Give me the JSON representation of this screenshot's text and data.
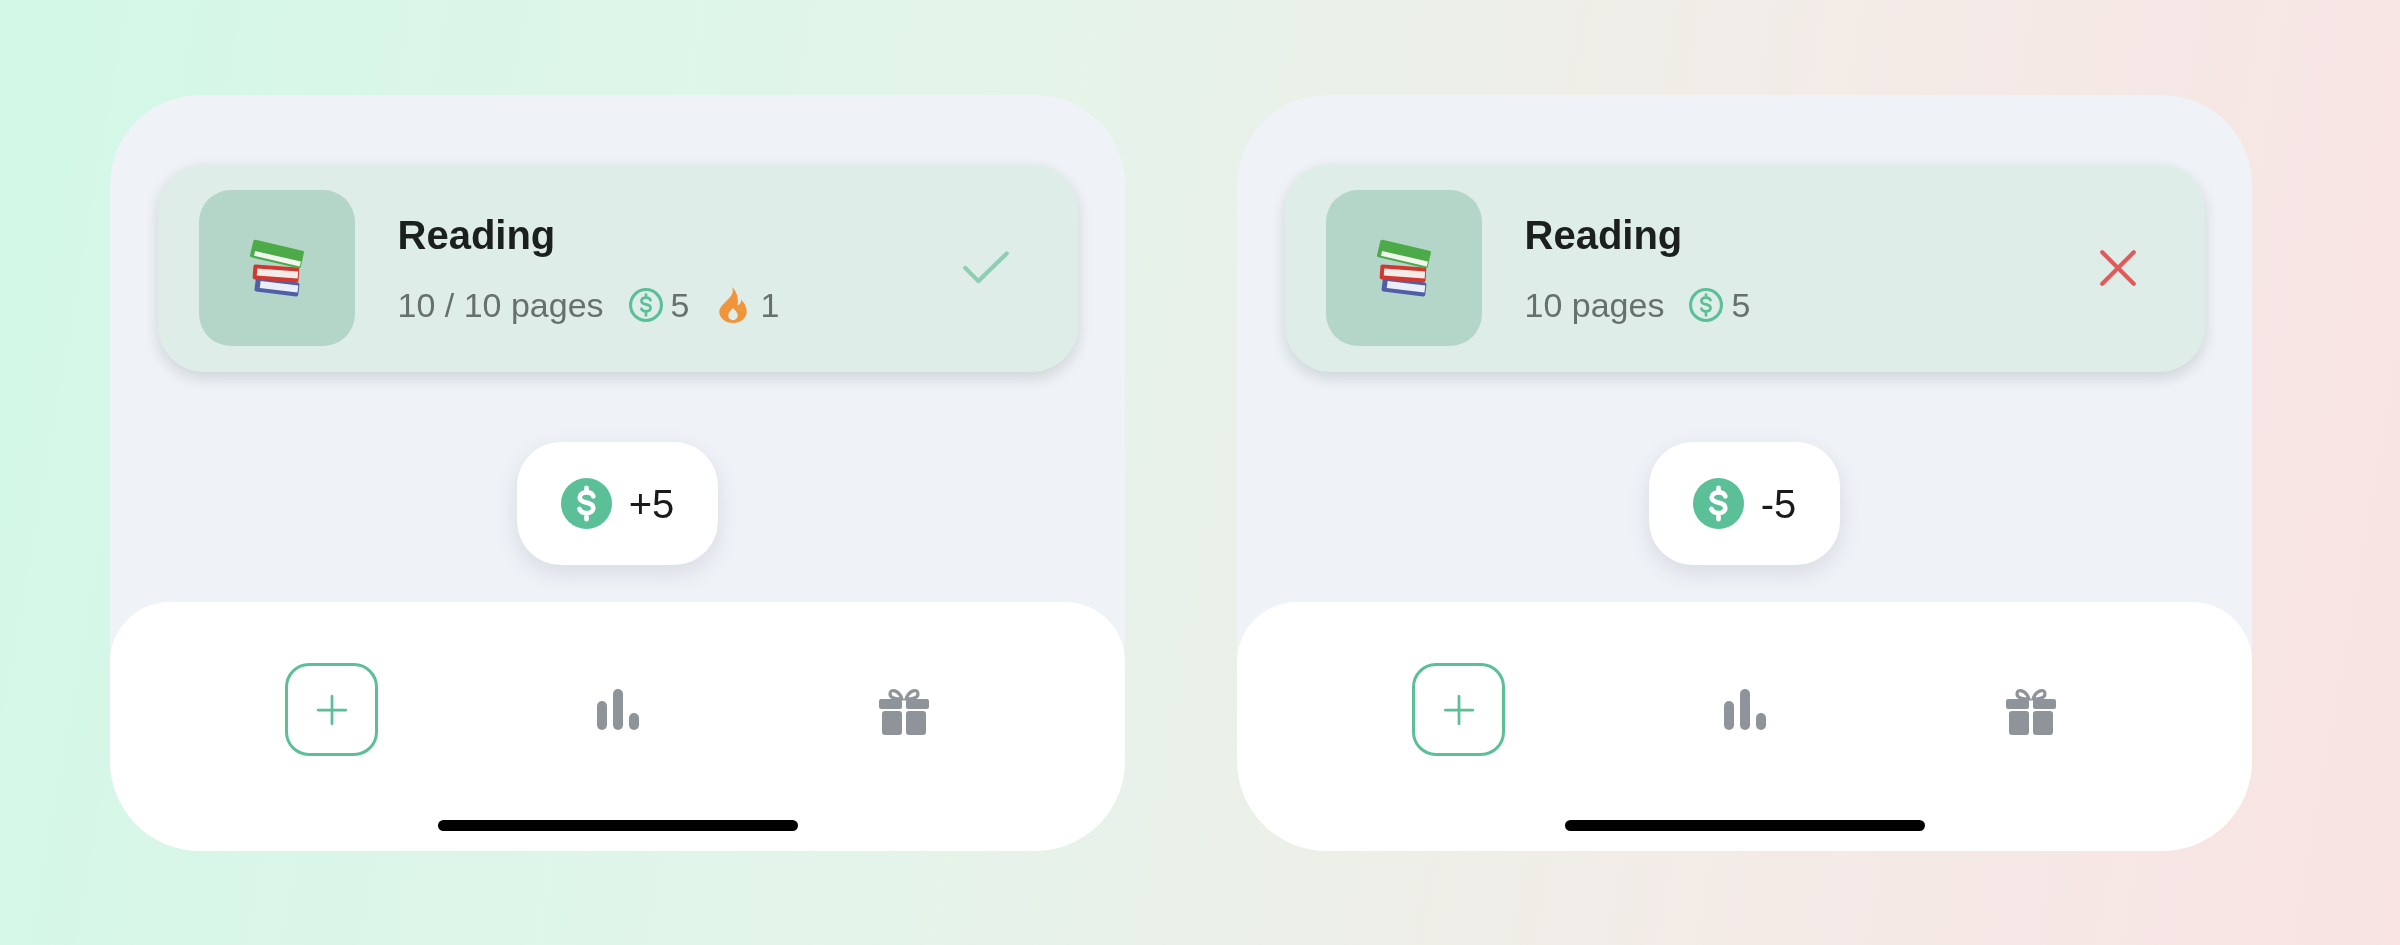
{
  "screens": [
    {
      "habit": {
        "title": "Reading",
        "subtitle": "10 / 10 pages",
        "coins": "5",
        "streak": "1",
        "completed": true
      },
      "toast": {
        "amount": "+5"
      },
      "nav": {
        "items": [
          {
            "kind": "add"
          },
          {
            "kind": "stats"
          },
          {
            "kind": "rewards"
          }
        ]
      }
    },
    {
      "habit": {
        "title": "Reading",
        "subtitle": "10 pages",
        "coins": "5",
        "completed": false
      },
      "toast": {
        "amount": "-5"
      },
      "nav": {
        "items": [
          {
            "kind": "add"
          },
          {
            "kind": "stats"
          },
          {
            "kind": "rewards"
          }
        ]
      }
    }
  ]
}
